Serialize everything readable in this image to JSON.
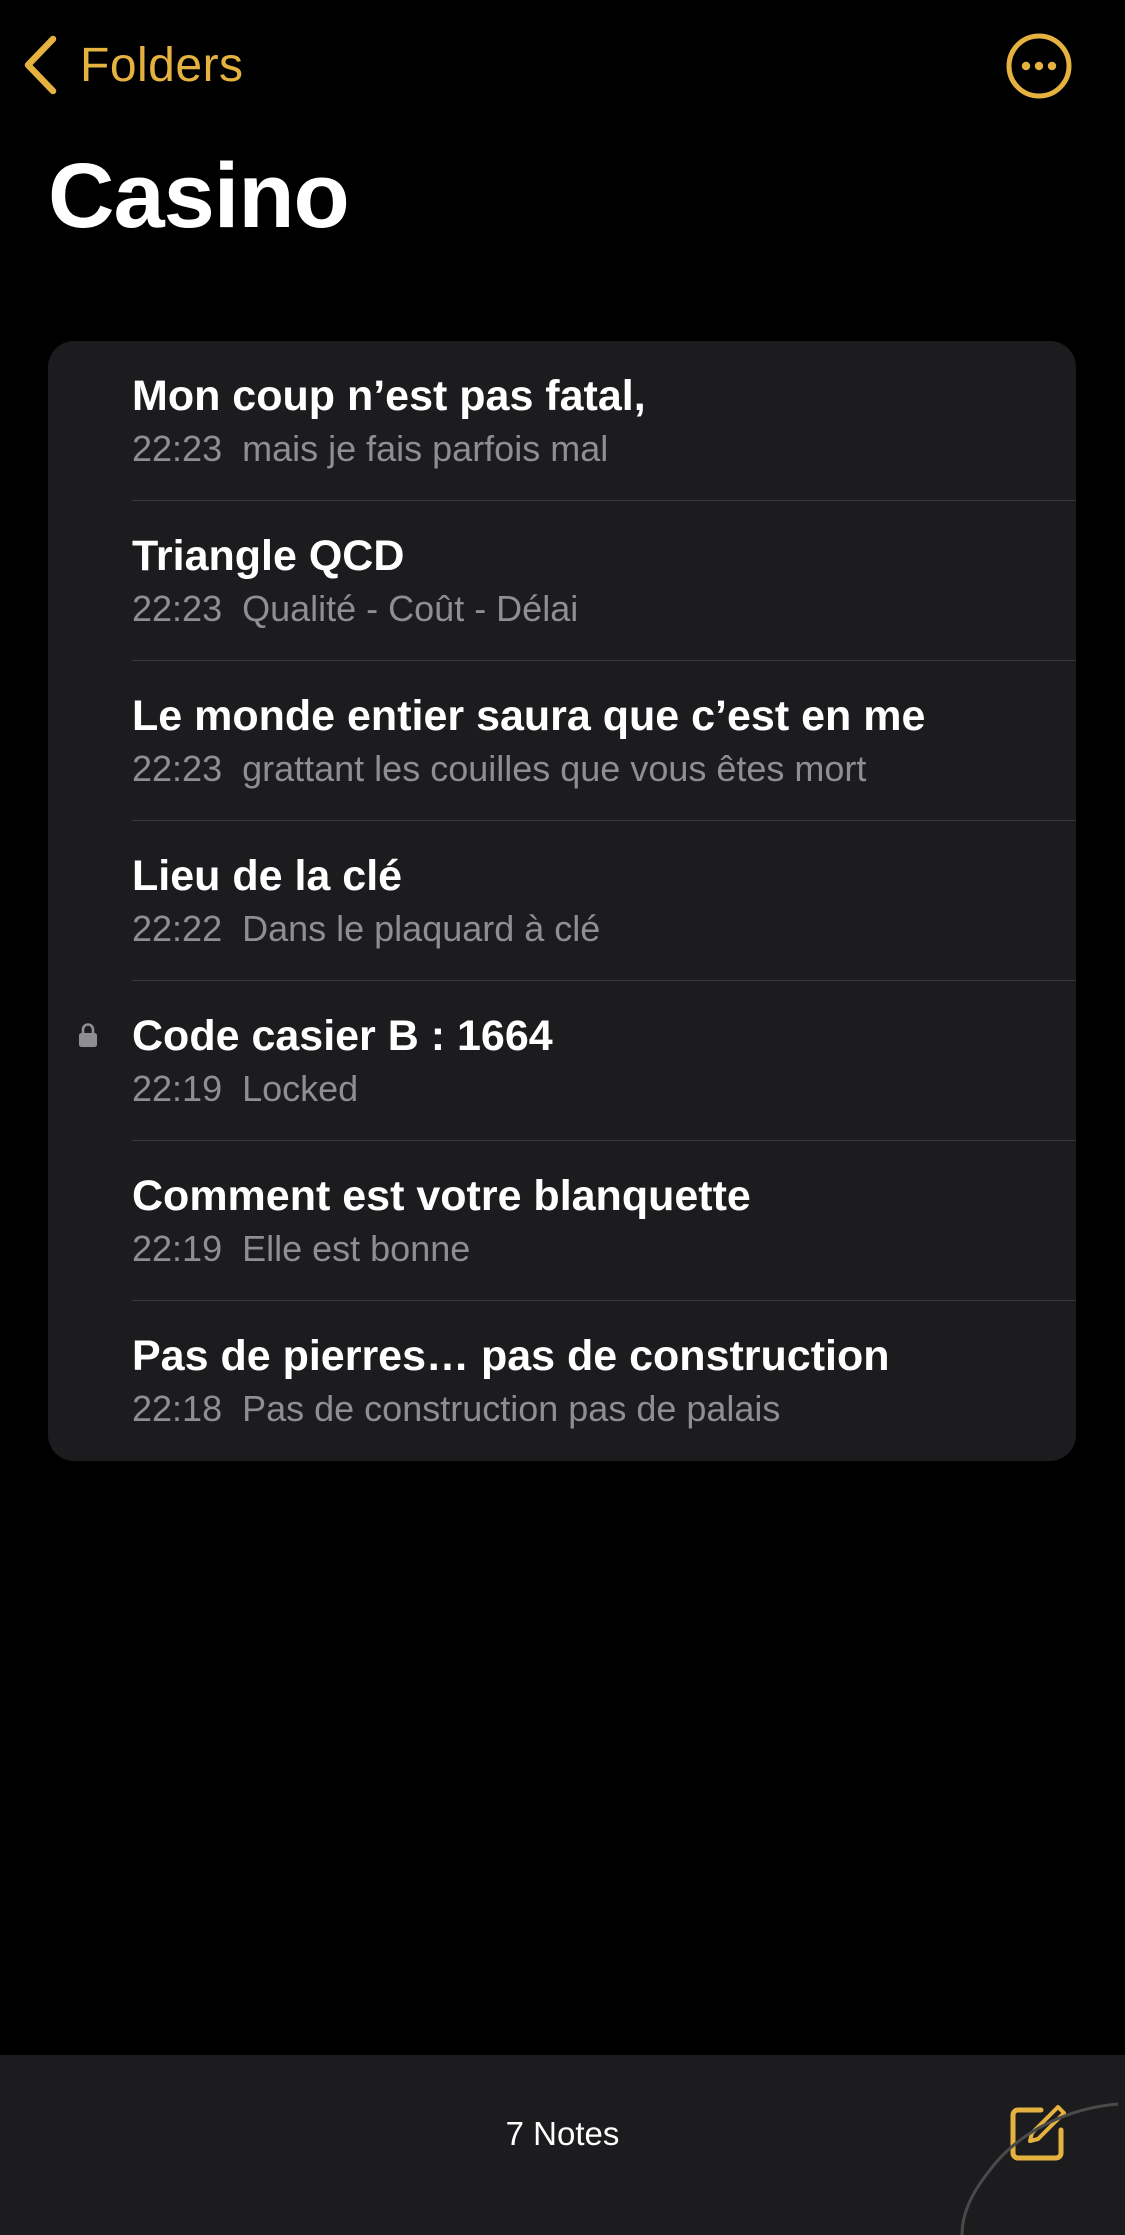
{
  "nav": {
    "back_label": "Folders",
    "back_icon": "chevron-left-icon",
    "more_icon": "ellipsis-circle-icon"
  },
  "page": {
    "title": "Casino"
  },
  "notes": [
    {
      "title": "Mon coup n’est pas fatal,",
      "time": "22:23",
      "preview": "mais je fais parfois mal",
      "locked": false
    },
    {
      "title": "Triangle QCD",
      "time": "22:23",
      "preview": "Qualité - Coût - Délai",
      "locked": false
    },
    {
      "title": "Le monde entier saura que c’est en me",
      "time": "22:23",
      "preview": "grattant les couilles que vous êtes mort",
      "locked": false
    },
    {
      "title": "Lieu de la clé",
      "time": "22:22",
      "preview": "Dans le plaquard à clé",
      "locked": false
    },
    {
      "title": "Code casier B : 1664",
      "time": "22:19",
      "preview": "Locked",
      "locked": true
    },
    {
      "title": "Comment est votre blanquette",
      "time": "22:19",
      "preview": "Elle est bonne",
      "locked": false
    },
    {
      "title": "Pas de pierres… pas de construction",
      "time": "22:18",
      "preview": "Pas de construction pas de palais",
      "locked": false
    }
  ],
  "toolbar": {
    "count_label": "7 Notes",
    "compose_icon": "compose-icon"
  },
  "colors": {
    "accent": "#E5B23F",
    "background": "#000000",
    "card": "#1C1C1E",
    "secondary_text": "#8E8E93",
    "divider": "#38383A"
  }
}
